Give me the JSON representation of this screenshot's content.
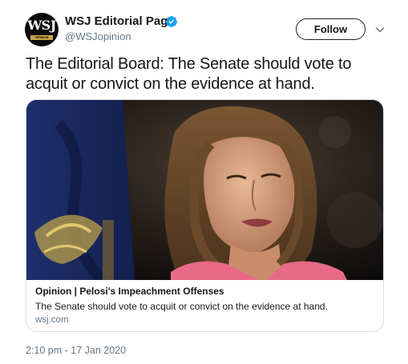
{
  "header": {
    "display_name": "WSJ Editorial Page",
    "handle": "@WSJopinion",
    "avatar_text": "WSJ",
    "avatar_subtext": "OPINION",
    "follow_label": "Follow",
    "verified_icon": "verified-badge-icon",
    "caret_icon": "chevron-down-icon"
  },
  "tweet": {
    "text": "The Editorial Board: The Senate should vote to acquit or convict on the evidence at hand.",
    "timestamp": "2:10 pm - 17 Jan 2020"
  },
  "card": {
    "title": "Opinion | Pelosi's Impeachment Offenses",
    "description": "The Senate should vote to acquit or convict on the evidence at hand.",
    "domain": "wsj.com"
  },
  "colors": {
    "text": "#14171a",
    "muted": "#657786",
    "verified_blue": "#1da1f2",
    "card_border": "#d7dfe4",
    "jacket_pink": "#e86a86"
  }
}
